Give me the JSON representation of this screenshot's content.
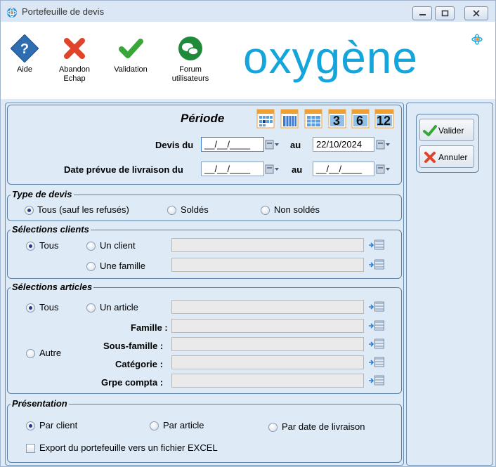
{
  "window": {
    "title": "Portefeuille de devis"
  },
  "toolbar": {
    "aide": "Aide",
    "abandon": "Abandon",
    "abandon_sub": "Echap",
    "validation": "Validation",
    "forum": "Forum",
    "forum_sub": "utilisateurs",
    "logo": "oxygène"
  },
  "periode": {
    "title": "Période",
    "quick_buttons": [
      "3",
      "6",
      "12"
    ],
    "devis_du_label": "Devis du",
    "devis_du_value": "__/__/____",
    "au_label": "au",
    "devis_au_value": "22/10/2024",
    "livraison_label": "Date prévue de livraison du",
    "livraison_du_value": "__/__/____",
    "livraison_au_value": "__/__/____"
  },
  "type_devis": {
    "title": "Type de devis",
    "options": [
      "Tous (sauf les refusés)",
      "Soldés",
      "Non soldés"
    ],
    "selected": "Tous (sauf les refusés)"
  },
  "clients": {
    "title": "Sélections clients",
    "tous": "Tous",
    "un_client": "Un client",
    "une_famille": "Une famille",
    "selected": "Tous"
  },
  "articles": {
    "title": "Sélections articles",
    "tous": "Tous",
    "un_article": "Un article",
    "autre": "Autre",
    "famille": "Famille :",
    "sous_famille": "Sous-famille :",
    "categorie": "Catégorie :",
    "grpe_compta": "Grpe compta :",
    "selected": "Tous"
  },
  "presentation": {
    "title": "Présentation",
    "par_client": "Par client",
    "par_article": "Par article",
    "par_date": "Par date de livraison",
    "selected": "Par client",
    "export_label": "Export du portefeuille vers un fichier EXCEL",
    "export_checked": false
  },
  "side": {
    "valider": "Valider",
    "annuler": "Annuler"
  },
  "colors": {
    "accent": "#14a5dc",
    "validate": "#3aa63a",
    "cancel": "#e0442a"
  }
}
